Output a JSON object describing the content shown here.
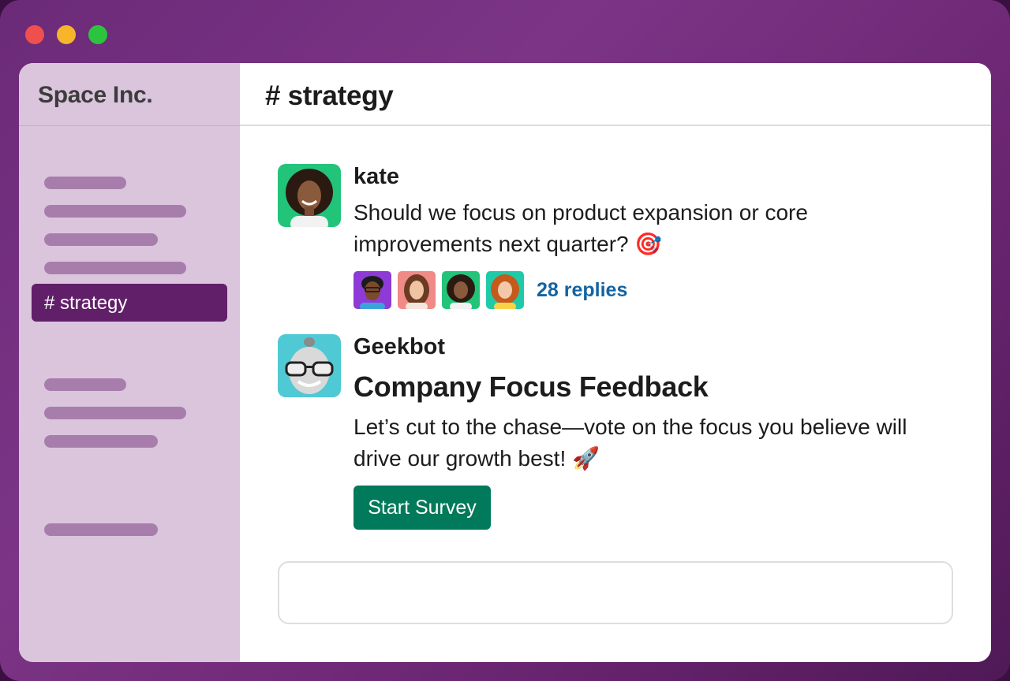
{
  "workspace": {
    "name": "Space Inc."
  },
  "sidebar": {
    "active_channel": "# strategy"
  },
  "channel": {
    "title": "# strategy"
  },
  "messages": [
    {
      "author": "kate",
      "text_line1": "Should we focus on product expansion or core",
      "text_line2": "improvements next quarter? 🎯",
      "replies": "28 replies"
    },
    {
      "author": "Geekbot",
      "title": "Company Focus Feedback",
      "text_line1": "Let’s cut to the chase—vote on the focus you believe will",
      "text_line2": "drive our growth best! 🚀",
      "button_label": "Start Survey"
    }
  ],
  "composer": {
    "placeholder": ""
  },
  "colors": {
    "sidebar_bg": "#dac5dd",
    "active_channel": "#611f69",
    "link": "#1264a3",
    "button": "#007a5a"
  }
}
